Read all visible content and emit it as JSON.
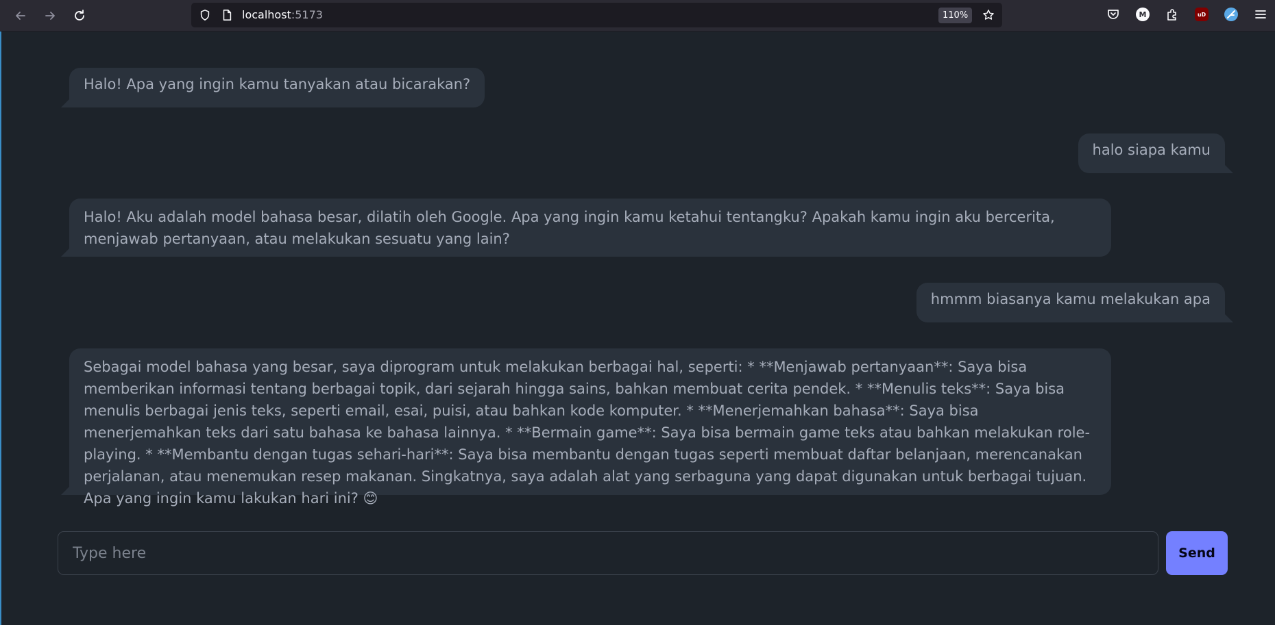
{
  "browser": {
    "url_host": "localhost",
    "url_port": ":5173",
    "zoom": "110%",
    "icons": [
      "back-icon",
      "forward-icon",
      "reload-icon",
      "shield-icon",
      "page-icon",
      "bookmark-star-icon",
      "pocket-icon",
      "account-icon",
      "extensions-icon",
      "ublock-icon",
      "extension-blue-icon",
      "menu-icon"
    ],
    "account_initial": "M",
    "ublock_label": "uD"
  },
  "chat": {
    "messages": [
      {
        "role": "bot",
        "text": "Halo! Apa yang ingin kamu tanyakan atau bicarakan?"
      },
      {
        "role": "user",
        "text": "halo siapa kamu"
      },
      {
        "role": "bot",
        "text": "Halo! Aku adalah model bahasa besar, dilatih oleh Google. Apa yang ingin kamu ketahui tentangku? Apakah kamu ingin aku bercerita, menjawab pertanyaan, atau melakukan sesuatu yang lain?"
      },
      {
        "role": "user",
        "text": "hmmm biasanya kamu melakukan apa"
      },
      {
        "role": "bot",
        "text": "Sebagai model bahasa yang besar, saya diprogram untuk melakukan berbagai hal, seperti: * **Menjawab pertanyaan**: Saya bisa memberikan informasi tentang berbagai topik, dari sejarah hingga sains, bahkan membuat cerita pendek. * **Menulis teks**: Saya bisa menulis berbagai jenis teks, seperti email, esai, puisi, atau bahkan kode komputer. * **Menerjemahkan bahasa**: Saya bisa menerjemahkan teks dari satu bahasa ke bahasa lainnya. * **Bermain game**: Saya bisa bermain game teks atau bahkan melakukan role-playing. * **Membantu dengan tugas sehari-hari**: Saya bisa membantu dengan tugas seperti membuat daftar belanjaan, merencanakan perjalanan, atau menemukan resep makanan. Singkatnya, saya adalah alat yang serbaguna yang dapat digunakan untuk berbagai tujuan. Apa yang ingin kamu lakukan hari ini? 😊"
      }
    ]
  },
  "composer": {
    "placeholder": "Type here",
    "value": "",
    "send_label": "Send"
  },
  "colors": {
    "page_bg": "#1d232a",
    "bubble_bg": "#2a323c",
    "text": "#a6adba",
    "accent": "#7480ff"
  }
}
